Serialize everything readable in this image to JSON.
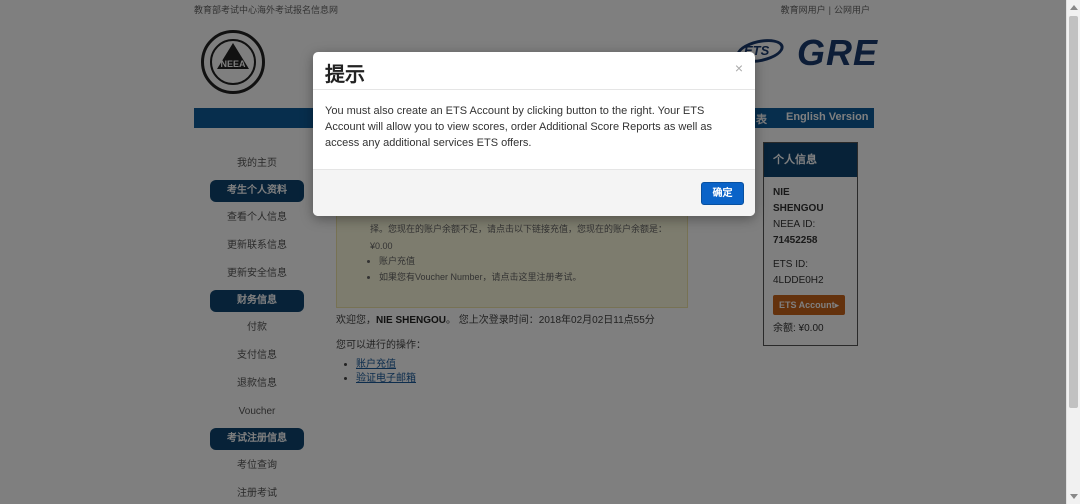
{
  "top_bar": {
    "site_name": "教育部考试中心海外考试报名信息网",
    "link_edu_user": "教育网用户",
    "separator": "|",
    "link_public_user": "公网用户"
  },
  "logos": {
    "neea_text": "NEEA",
    "ets_text": "ETS",
    "gre_text": "GRE"
  },
  "navbar": {
    "item_partial": "表",
    "english_version": "English Version"
  },
  "sidebar": {
    "items": [
      {
        "label": "我的主页",
        "kind": "link"
      },
      {
        "label": "考生个人资料",
        "kind": "head"
      },
      {
        "label": "查看个人信息",
        "kind": "link"
      },
      {
        "label": "更新联系信息",
        "kind": "link"
      },
      {
        "label": "更新安全信息",
        "kind": "link"
      },
      {
        "label": "财务信息",
        "kind": "head"
      },
      {
        "label": "付款",
        "kind": "link"
      },
      {
        "label": "支付信息",
        "kind": "link"
      },
      {
        "label": "退款信息",
        "kind": "link"
      },
      {
        "label": "Voucher",
        "kind": "link"
      },
      {
        "label": "考试注册信息",
        "kind": "head"
      },
      {
        "label": "考位查询",
        "kind": "link"
      },
      {
        "label": "注册考试",
        "kind": "link"
      }
    ]
  },
  "notice": {
    "text": "择。您现在的账户余额不足，请点击以下链接充值，您现在的账户余额是：¥0.00",
    "items": [
      "账户充值",
      "如果您有Voucher Number，请点击这里注册考试。"
    ]
  },
  "welcome": {
    "prefix": "欢迎您，",
    "name": "NIE SHENGOU",
    "suffix": "。 您上次登录时间：2018年02月02日11点55分"
  },
  "operations": {
    "label": "您可以进行的操作：",
    "links": [
      "账户充值",
      "验证电子邮箱"
    ]
  },
  "info_panel": {
    "title": "个人信息",
    "name_line1": "NIE",
    "name_line2": "SHENGOU",
    "neea_id_label": "NEEA ID:",
    "neea_id": "71452258",
    "ets_id_label": "ETS ID:",
    "ets_id": "4LDDE0H2",
    "ets_account_button": "ETS Account▸",
    "balance": "余额: ¥0.00"
  },
  "modal": {
    "title": "提示",
    "close": "×",
    "message": "You must also create an ETS Account by clicking button to the right. Your ETS Account will allow you to view scores, order Additional Score Reports as well as access any additional services ETS offers.",
    "ok_button": "确定"
  }
}
